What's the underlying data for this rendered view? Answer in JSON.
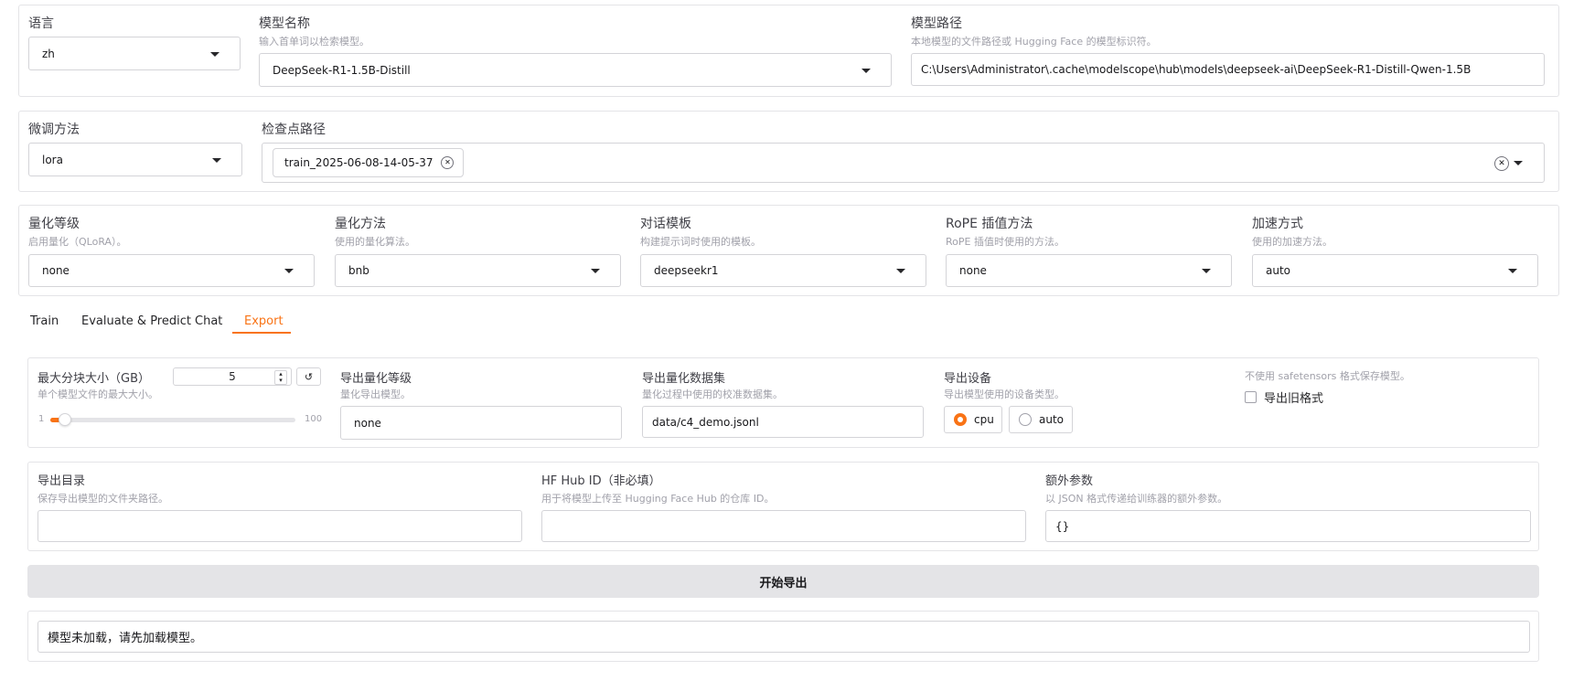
{
  "top": {
    "language": {
      "label": "语言",
      "value": "zh"
    },
    "model_name": {
      "label": "模型名称",
      "hint": "输入首单词以检索模型。",
      "value": "DeepSeek-R1-1.5B-Distill"
    },
    "model_path": {
      "label": "模型路径",
      "hint": "本地模型的文件路径或 Hugging Face 的模型标识符。",
      "value": "C:\\Users\\Administrator\\.cache\\modelscope\\hub\\models\\deepseek-ai\\DeepSeek-R1-Distill-Qwen-1.5B"
    }
  },
  "finetune": {
    "method": {
      "label": "微调方法",
      "value": "lora"
    },
    "checkpoint": {
      "label": "检查点路径",
      "tag": "train_2025-06-08-14-05-37"
    }
  },
  "advanced": {
    "quant_level": {
      "label": "量化等级",
      "hint": "启用量化（QLoRA）。",
      "value": "none"
    },
    "quant_method": {
      "label": "量化方法",
      "hint": "使用的量化算法。",
      "value": "bnb"
    },
    "template": {
      "label": "对话模板",
      "hint": "构建提示词时使用的模板。",
      "value": "deepseekr1"
    },
    "rope": {
      "label": "RoPE 插值方法",
      "hint": "RoPE 插值时使用的方法。",
      "value": "none"
    },
    "booster": {
      "label": "加速方式",
      "hint": "使用的加速方法。",
      "value": "auto"
    }
  },
  "tabs": [
    {
      "label": "Train"
    },
    {
      "label": "Evaluate & Predict"
    },
    {
      "label": "Chat"
    },
    {
      "label": "Export"
    }
  ],
  "export": {
    "max_shard": {
      "label": "最大分块大小（GB）",
      "hint": "单个模型文件的最大大小。",
      "value": "5",
      "min": "1",
      "max": "100",
      "fraction": 0.04,
      "reset": "↺"
    },
    "quant_bit": {
      "label": "导出量化等级",
      "hint": "量化导出模型。",
      "value": "none"
    },
    "quant_dataset": {
      "label": "导出量化数据集",
      "hint": "量化过程中使用的校准数据集。",
      "value": "data/c4_demo.jsonl"
    },
    "device": {
      "label": "导出设备",
      "hint": "导出模型使用的设备类型。",
      "options": [
        "cpu",
        "auto"
      ],
      "selected": "cpu"
    },
    "legacy": {
      "hint": "不使用 safetensors 格式保存模型。",
      "label": "导出旧格式",
      "checked": false
    },
    "export_dir": {
      "label": "导出目录",
      "hint": "保存导出模型的文件夹路径。",
      "value": ""
    },
    "hub_id": {
      "label": "HF Hub ID（非必填）",
      "hint": "用于将模型上传至 Hugging Face Hub 的仓库 ID。",
      "value": ""
    },
    "extra_args": {
      "label": "额外参数",
      "hint": "以 JSON 格式传递给训练器的额外参数。",
      "value": "{}"
    },
    "button": "开始导出",
    "output": "模型未加载，请先加载模型。"
  },
  "colors": {
    "accent": "#f97316",
    "border": "#e4e4e7",
    "button_bg": "#e4e4e7"
  }
}
